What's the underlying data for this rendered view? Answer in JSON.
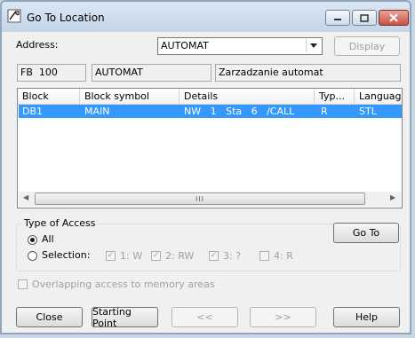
{
  "window": {
    "title": "Go To Location"
  },
  "address": {
    "label": "Address:",
    "value": "AUTOMAT",
    "display_button": "Display"
  },
  "info": {
    "type": "FB",
    "number": "100",
    "name": "AUTOMAT",
    "comment": "Zarzadzanie automat"
  },
  "table": {
    "columns": [
      "Block",
      "Block symbol",
      "Details",
      "Typ...",
      "Language"
    ],
    "rows": [
      {
        "block": "DB1",
        "symbol": "MAIN",
        "details": "NW   1   Sta   6   /CALL",
        "type": "R",
        "language": "STL"
      }
    ],
    "scroll_thumb": "III"
  },
  "access": {
    "title": "Type of Access",
    "all_label": "All",
    "selection_label": "Selection:",
    "options": [
      "1: W",
      "2: RW",
      "3: ?",
      "4: R"
    ],
    "go_to_button": "Go To"
  },
  "overlap_label": "Overlapping access to memory areas",
  "footer": {
    "close": "Close",
    "starting_point": "Starting Point",
    "prev": "<<",
    "next": ">>",
    "help": "Help"
  }
}
